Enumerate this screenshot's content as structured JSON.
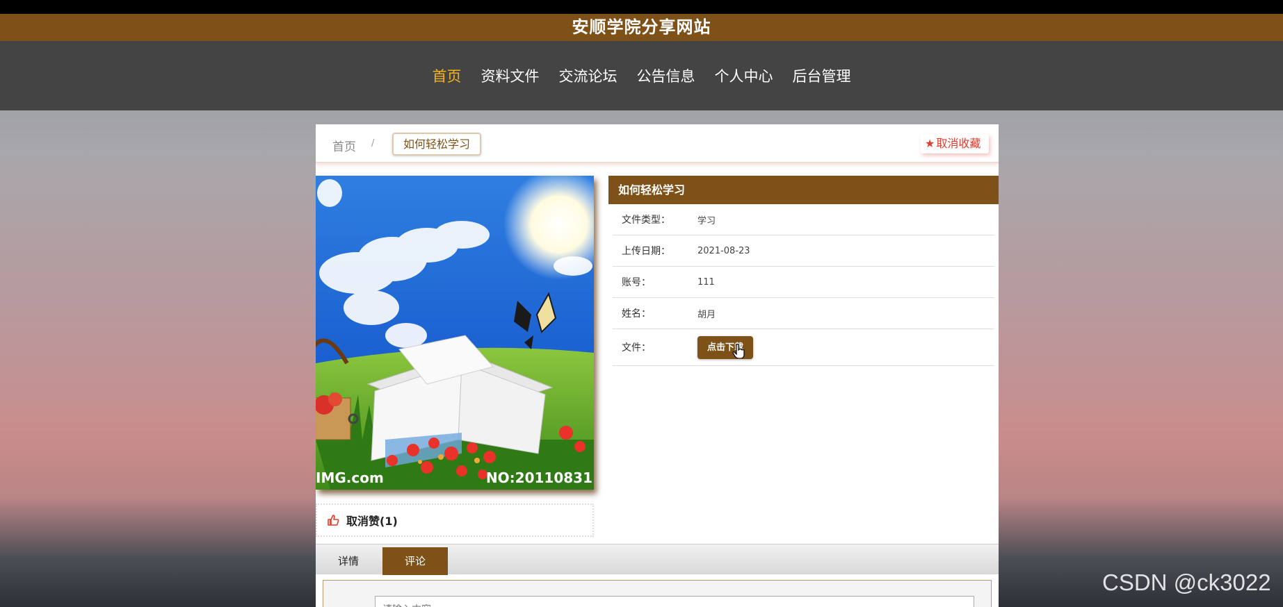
{
  "site": {
    "title": "安顺学院分享网站"
  },
  "nav": {
    "items": [
      {
        "label": "首页",
        "active": true
      },
      {
        "label": "资料文件"
      },
      {
        "label": "交流论坛"
      },
      {
        "label": "公告信息"
      },
      {
        "label": "个人中心"
      },
      {
        "label": "后台管理"
      }
    ]
  },
  "breadcrumb": {
    "home": "首页",
    "separator": "/",
    "current": "如何轻松学习"
  },
  "favorite": {
    "label": "取消收藏",
    "icon": "star-icon"
  },
  "picture": {
    "watermark_left": "IMG.com",
    "watermark_right": "NO:20110831"
  },
  "like": {
    "label": "取消赞(1)",
    "icon": "thumbs-up-icon"
  },
  "details": {
    "title": "如何轻松学习",
    "rows": [
      {
        "label": "文件类型：",
        "value": "学习"
      },
      {
        "label": "上传日期：",
        "value": "2021-08-23"
      },
      {
        "label": "账号：",
        "value": "111"
      },
      {
        "label": "姓名：",
        "value": "胡月"
      },
      {
        "label": "文件：",
        "button": "点击下载"
      }
    ]
  },
  "tabs": [
    {
      "label": "详情"
    },
    {
      "label": "评论",
      "active": true
    }
  ],
  "comment": {
    "placeholder": "请输入内容"
  },
  "watermark": "CSDN @ck3022",
  "colors": {
    "brand": "#7e5118",
    "nav_bg": "#444444",
    "nav_active": "#f4b21f",
    "favorite": "#e23b2e"
  }
}
